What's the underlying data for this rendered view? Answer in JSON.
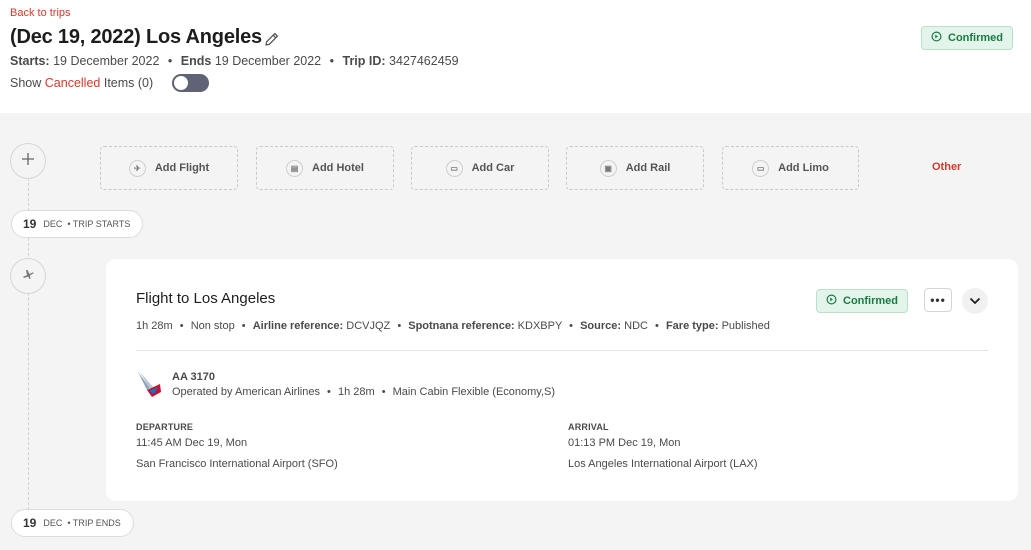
{
  "header": {
    "back_link": "Back to trips",
    "title": "(Dec 19, 2022) Los Angeles",
    "status": "Confirmed",
    "starts_label": "Starts:",
    "starts_value": "19 December 2022",
    "ends_label": "Ends",
    "ends_value": "19 December 2022",
    "trip_id_label": "Trip ID:",
    "trip_id_value": "3427462459",
    "show_prefix": "Show",
    "show_cancelled": "Cancelled",
    "show_suffix": "Items (0)",
    "toggle_on": false
  },
  "add_bar": {
    "items": [
      {
        "label": "Add Flight",
        "icon": "plane-icon"
      },
      {
        "label": "Add Hotel",
        "icon": "bed-icon"
      },
      {
        "label": "Add Car",
        "icon": "car-icon"
      },
      {
        "label": "Add Rail",
        "icon": "train-icon"
      },
      {
        "label": "Add Limo",
        "icon": "limo-icon"
      }
    ],
    "other": "Other"
  },
  "timeline": {
    "start": {
      "day": "19",
      "month": "DEC",
      "label": "• TRIP STARTS"
    },
    "end": {
      "day": "19",
      "month": "DEC",
      "label": "• TRIP ENDS"
    }
  },
  "flight": {
    "title": "Flight to Los Angeles",
    "status": "Confirmed",
    "more": "•••",
    "duration": "1h 28m",
    "stops": "Non stop",
    "airline_ref_label": "Airline reference:",
    "airline_ref_value": "DCVJQZ",
    "spotnana_ref_label": "Spotnana reference:",
    "spotnana_ref_value": "KDXBPY",
    "source_label": "Source:",
    "source_value": "NDC",
    "fare_label": "Fare type:",
    "fare_value": "Published",
    "number": "AA 3170",
    "operated_by": "Operated by American Airlines",
    "segment_duration": "1h 28m",
    "cabin": "Main Cabin Flexible (Economy,S)",
    "departure": {
      "label": "DEPARTURE",
      "time": "11:45 AM Dec 19, Mon",
      "airport": "San Francisco International Airport (SFO)"
    },
    "arrival": {
      "label": "ARRIVAL",
      "time": "01:13 PM Dec 19, Mon",
      "airport": "Los Angeles International Airport (LAX)"
    }
  },
  "colors": {
    "accent_red": "#d33a2c",
    "confirmed_green": "#1a7a45",
    "confirmed_bg": "#e3f4ea",
    "toggle_off": "#5f6375"
  }
}
